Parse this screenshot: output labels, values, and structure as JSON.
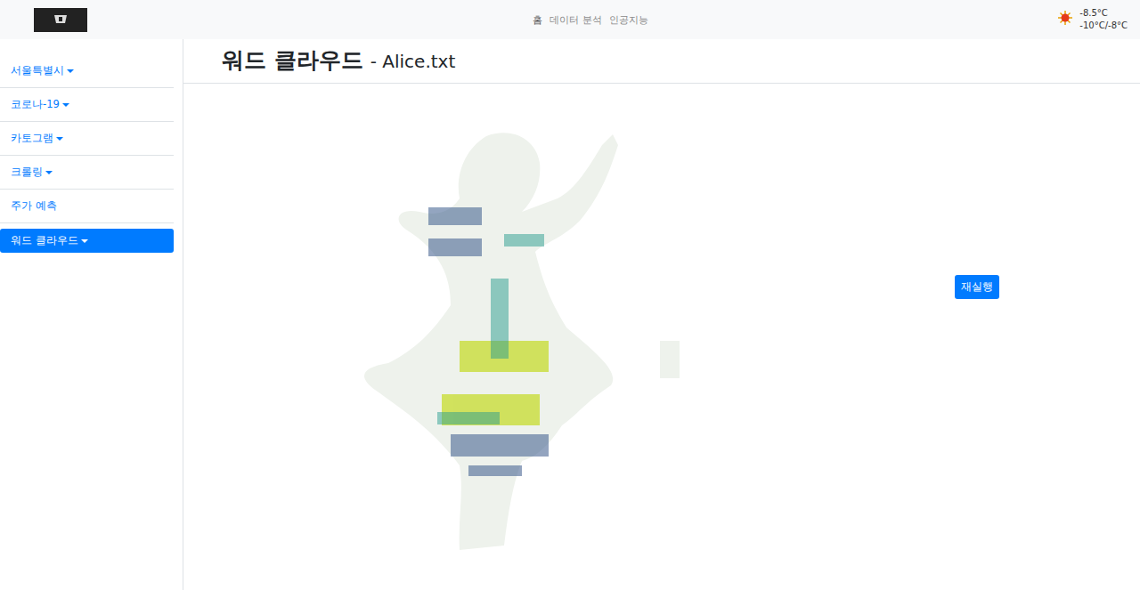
{
  "nav": {
    "items": [
      {
        "label": "홈",
        "selected": true
      },
      {
        "label": "데이터 분석",
        "selected": false
      },
      {
        "label": "인공지능",
        "selected": false
      }
    ]
  },
  "weather": {
    "current": "-8.5°C",
    "range": "-10°C/-8°C"
  },
  "sidebar": {
    "items": [
      {
        "label": "서울특별시",
        "dropdown": true,
        "selected": false
      },
      {
        "label": "코로나-19",
        "dropdown": true,
        "selected": false
      },
      {
        "label": "카토그램",
        "dropdown": true,
        "selected": false
      },
      {
        "label": "크롤링",
        "dropdown": true,
        "selected": false
      },
      {
        "label": "주가 예측",
        "dropdown": false,
        "selected": false
      },
      {
        "label": "워드 클라우드",
        "dropdown": true,
        "selected": true
      }
    ]
  },
  "page": {
    "title": "워드 클라우드",
    "subtitle": "- Alice.txt"
  },
  "buttons": [
    "재실행"
  ]
}
